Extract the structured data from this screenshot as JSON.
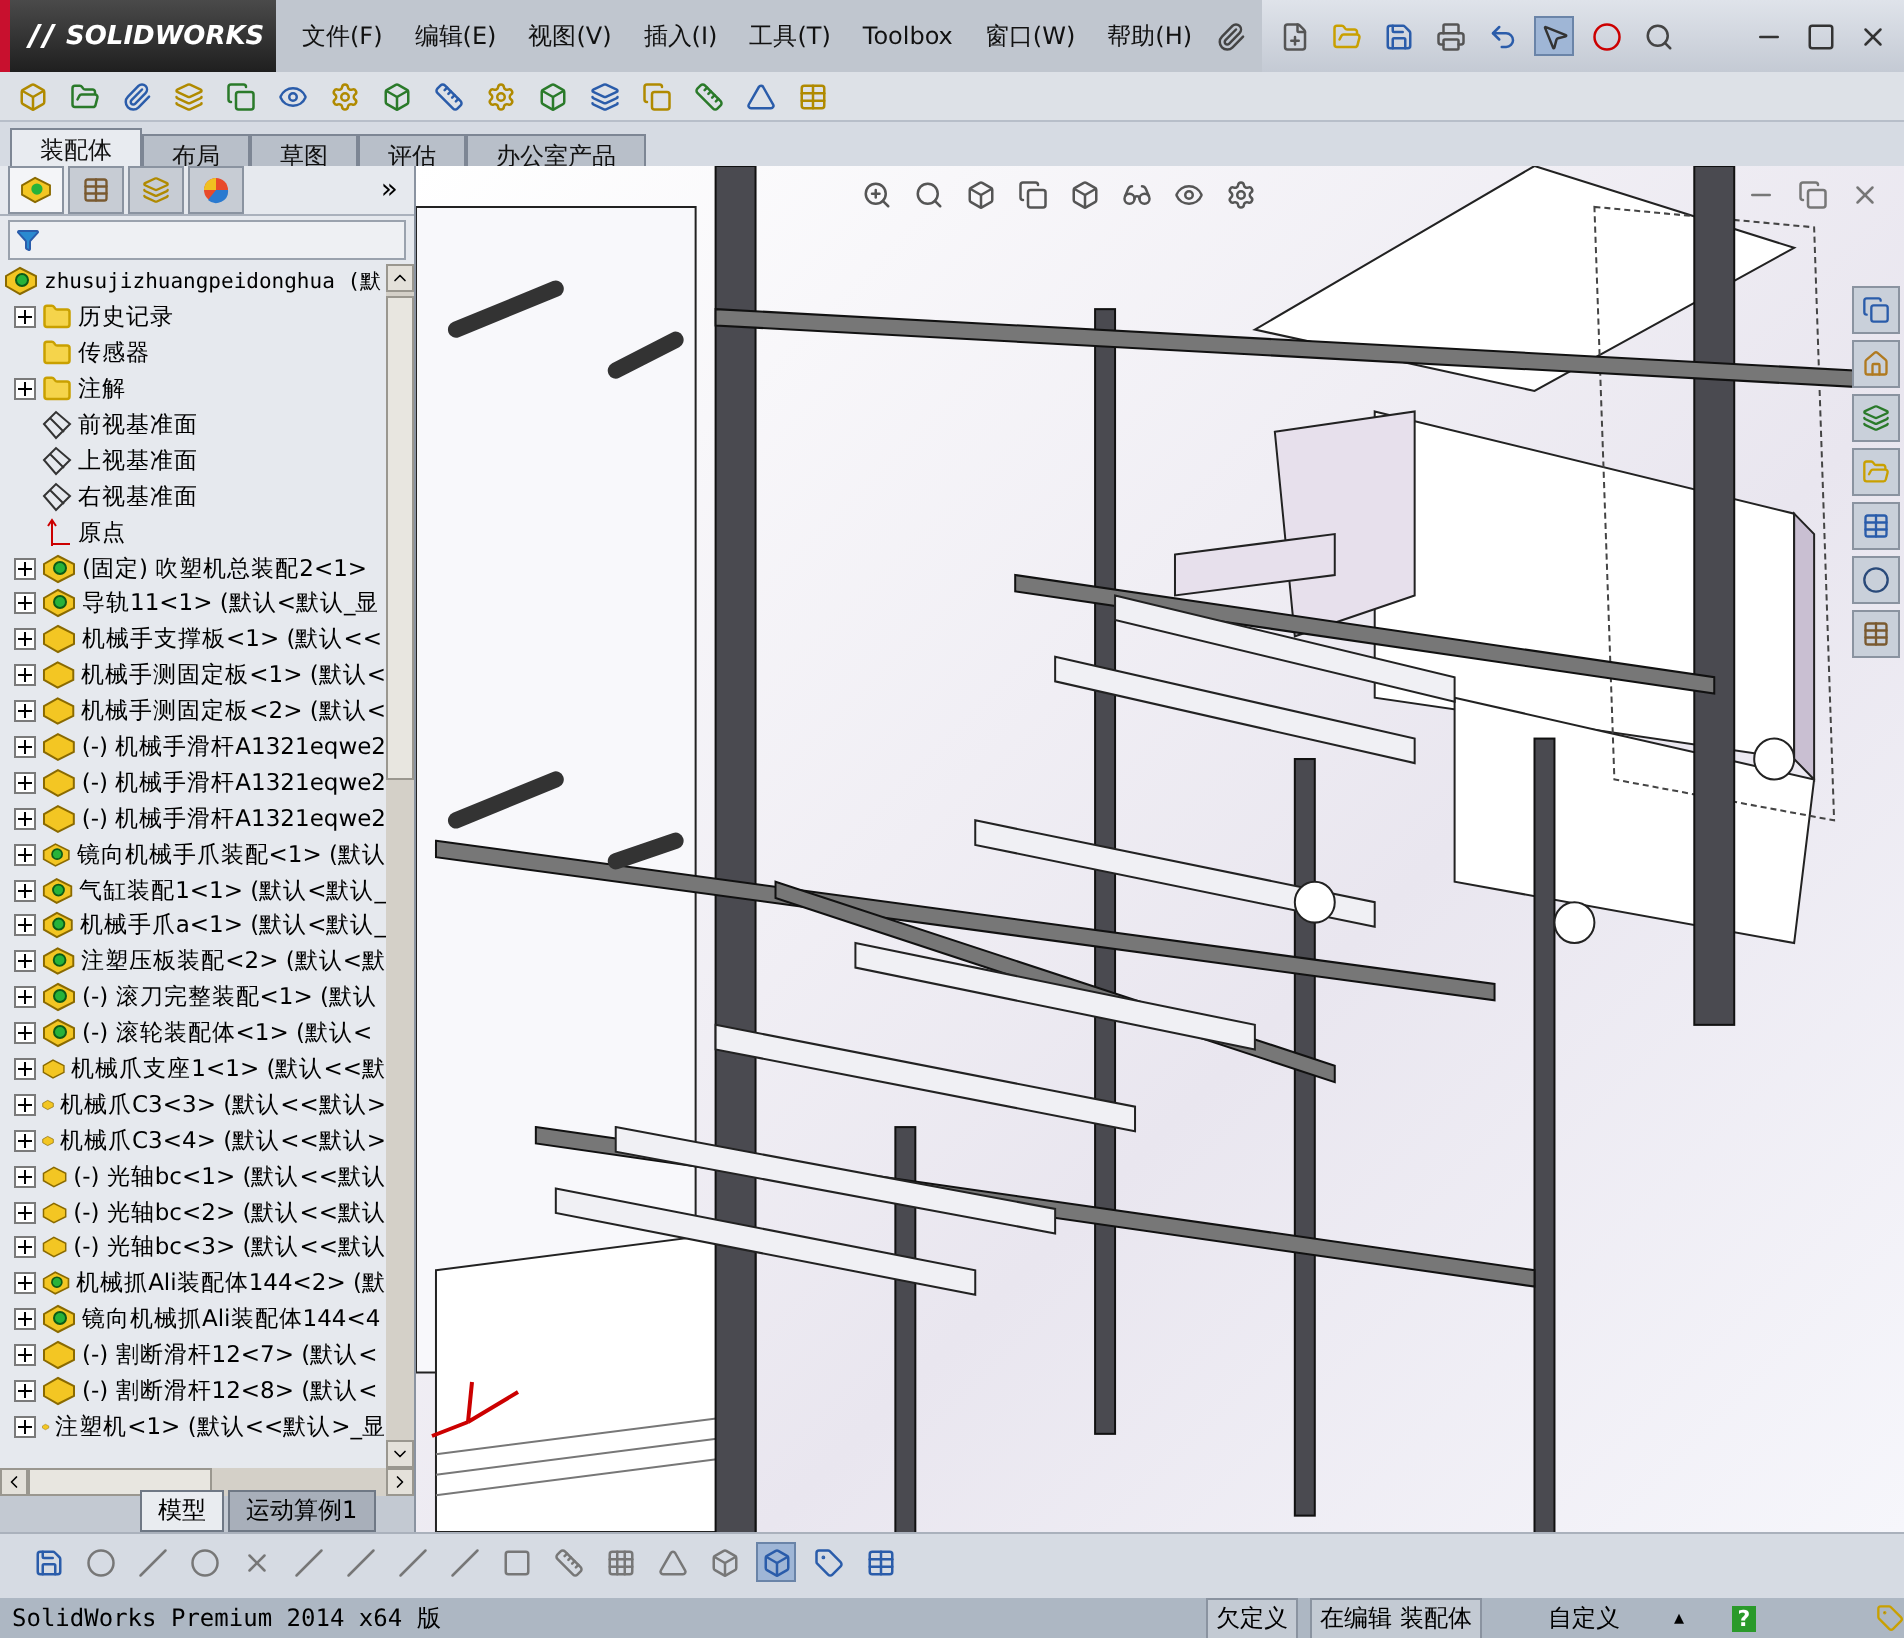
{
  "app": {
    "logo": "SOLIDWORKS"
  },
  "menu": [
    {
      "label": "文件(F)"
    },
    {
      "label": "编辑(E)"
    },
    {
      "label": "视图(V)"
    },
    {
      "label": "插入(I)"
    },
    {
      "label": "工具(T)"
    },
    {
      "label": "Toolbox"
    },
    {
      "label": "窗口(W)"
    },
    {
      "label": "帮助(H)"
    }
  ],
  "command_tabs": [
    {
      "label": "装配体",
      "selected": true
    },
    {
      "label": "布局",
      "selected": false
    },
    {
      "label": "草图",
      "selected": false
    },
    {
      "label": "评估",
      "selected": false
    },
    {
      "label": "办公室产品",
      "selected": false
    }
  ],
  "panel_tabs": [
    {
      "kind": "tree",
      "selected": true
    },
    {
      "kind": "property",
      "selected": false
    },
    {
      "kind": "config",
      "selected": false
    },
    {
      "kind": "appearance",
      "selected": false
    }
  ],
  "panel_more": "»",
  "tree": {
    "root": "zhusujizhuangpeidonghua  (默",
    "items": [
      {
        "kind": "history",
        "label": "历史记录",
        "expandable": true
      },
      {
        "kind": "sensor",
        "label": "传感器",
        "expandable": false
      },
      {
        "kind": "annotation",
        "label": "注解",
        "expandable": true
      },
      {
        "kind": "plane",
        "label": "前视基准面",
        "expandable": false
      },
      {
        "kind": "plane",
        "label": "上视基准面",
        "expandable": false
      },
      {
        "kind": "plane",
        "label": "右视基准面",
        "expandable": false
      },
      {
        "kind": "origin",
        "label": "原点",
        "expandable": false
      },
      {
        "kind": "assembly",
        "label": "(固定) 吹塑机总装配2<1>",
        "expandable": true
      },
      {
        "kind": "assembly",
        "label": "导轨11<1> (默认<默认_显",
        "expandable": true
      },
      {
        "kind": "part",
        "label": "机械手支撑板<1> (默认<<",
        "expandable": true
      },
      {
        "kind": "part",
        "label": "机械手测固定板<1> (默认<",
        "expandable": true
      },
      {
        "kind": "part",
        "label": "机械手测固定板<2> (默认<",
        "expandable": true
      },
      {
        "kind": "part",
        "label": "(-) 机械手滑杆A1321eqwe2",
        "expandable": true
      },
      {
        "kind": "part",
        "label": "(-) 机械手滑杆A1321eqwe2",
        "expandable": true
      },
      {
        "kind": "part",
        "label": "(-) 机械手滑杆A1321eqwe2",
        "expandable": true
      },
      {
        "kind": "assembly",
        "label": "镜向机械手爪装配<1> (默认",
        "expandable": true
      },
      {
        "kind": "assembly",
        "label": "气缸装配1<1> (默认<默认_",
        "expandable": true
      },
      {
        "kind": "assembly",
        "label": "机械手爪a<1> (默认<默认_",
        "expandable": true
      },
      {
        "kind": "assembly",
        "label": "注塑压板装配<2> (默认<默",
        "expandable": true
      },
      {
        "kind": "assembly",
        "label": "(-) 滚刀完整装配<1> (默认",
        "expandable": true
      },
      {
        "kind": "assembly",
        "label": "(-) 滚轮装配体<1> (默认<",
        "expandable": true
      },
      {
        "kind": "part",
        "label": "机械爪支座1<1> (默认<<默",
        "expandable": true
      },
      {
        "kind": "part",
        "label": "机械爪C3<3> (默认<<默认>",
        "expandable": true
      },
      {
        "kind": "part",
        "label": "机械爪C3<4> (默认<<默认>",
        "expandable": true
      },
      {
        "kind": "part",
        "label": "(-) 光轴bc<1> (默认<<默认",
        "expandable": true
      },
      {
        "kind": "part",
        "label": "(-) 光轴bc<2> (默认<<默认",
        "expandable": true
      },
      {
        "kind": "part",
        "label": "(-) 光轴bc<3> (默认<<默认",
        "expandable": true
      },
      {
        "kind": "assembly",
        "label": "机械抓Ali装配体144<2> (默",
        "expandable": true
      },
      {
        "kind": "assembly",
        "label": "镜向机械抓Ali装配体144<4",
        "expandable": true
      },
      {
        "kind": "part",
        "label": "(-) 割断滑杆12<7> (默认<",
        "expandable": true
      },
      {
        "kind": "part",
        "label": "(-) 割断滑杆12<8> (默认<",
        "expandable": true
      },
      {
        "kind": "part",
        "label": "注塑机<1> (默认<<默认>_显",
        "expandable": true
      }
    ]
  },
  "bottom_tabs": [
    {
      "label": "模型",
      "selected": true
    },
    {
      "label": "运动算例1",
      "selected": false
    }
  ],
  "status_bar": {
    "product": "SolidWorks Premium 2014 x64 版",
    "state": "欠定义",
    "mode": "在编辑 装配体",
    "units": "自定义",
    "units_arrow": "▴",
    "help": "?"
  }
}
